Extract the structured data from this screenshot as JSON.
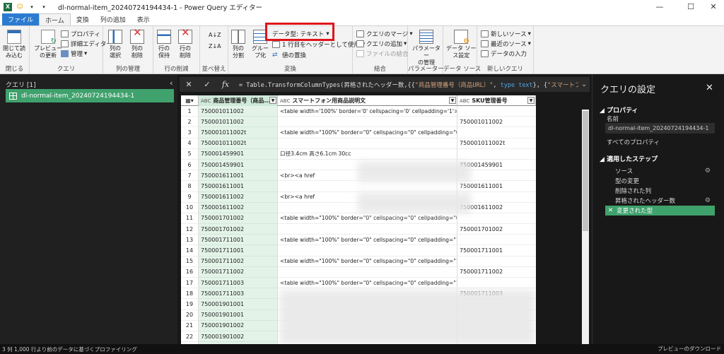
{
  "titlebar": {
    "title": "dl-normal-item_20240724194434-1 - Power Query エディター"
  },
  "tabs": [
    "ファイル",
    "ホーム",
    "変換",
    "列の追加",
    "表示"
  ],
  "ribbon": {
    "close": {
      "label1": "閉じて読",
      "label2": "み込む",
      "group": "閉じる"
    },
    "query": {
      "preview1": "プレビュー",
      "preview2": "の更新",
      "properties": "プロパティ",
      "advanced": "詳細エディター",
      "manage": "管理",
      "group": "クエリ"
    },
    "columns": {
      "select1": "列の",
      "select2": "選択",
      "delete1": "列の",
      "delete2": "削除",
      "group": "列の管理"
    },
    "rows": {
      "keep1": "行の",
      "keep2": "保持",
      "remove1": "行の",
      "remove2": "削除",
      "group": "行の削減"
    },
    "sort": {
      "group": "並べ替え"
    },
    "transform": {
      "split1": "列の",
      "split2": "分割",
      "group1": "グルー",
      "group2": "プ化",
      "datatype": "データ型: テキスト",
      "header": "1 行目をヘッダーとして使用",
      "replace": "値の置換",
      "group": "変換"
    },
    "combine": {
      "merge": "クエリのマージ",
      "append": "クエリの追加",
      "combine": "ファイルの結合",
      "group": "結合"
    },
    "params": {
      "l1": "パラメーター",
      "l2": "の管理",
      "group": "パラメーター"
    },
    "datasource": {
      "l1": "データ ソー",
      "l2": "ス設定",
      "group": "データ ソース"
    },
    "newquery": {
      "newsource": "新しいソース",
      "recent": "最近のソース",
      "enter": "データの入力",
      "group": "新しいクエリ"
    }
  },
  "queries": {
    "header": "クエリ [1]",
    "item": "dl-normal-item_20240724194434-1"
  },
  "formula": {
    "prefix": "= Table.TransformColumnTypes(昇格されたヘッダー数,{{",
    "s1": "\"商品管理番号（商品URL）\"",
    "mid": ", ",
    "k1": "type text",
    "tail": "}, {",
    "s2": "\"スマートフォ"
  },
  "grid": {
    "columns": [
      "商品管理番号（商品...",
      "スマートフォン用商品説明文",
      "SKU管理番号"
    ],
    "types": [
      "ABC",
      "ABC",
      "ABC"
    ],
    "rows": [
      {
        "n": "1",
        "a": "750001011002",
        "b": "<table width='100%' border='0' cellspacing='0' cellpadding='1'><tr><td...",
        "c": ""
      },
      {
        "n": "2",
        "a": "750001011002",
        "b": "",
        "c": "750001011002"
      },
      {
        "n": "3",
        "a": "750001011002t",
        "b": "<table width=\"100%\" border=\"0\" cellspacing=\"0\" cellpadding=\"0\"><tr>...",
        "c": ""
      },
      {
        "n": "4",
        "a": "750001011002t",
        "b": "",
        "c": "750001011002t"
      },
      {
        "n": "5",
        "a": "750001459901",
        "b": "口径3.4cm 高さ6.1cm 30cc",
        "c": ""
      },
      {
        "n": "6",
        "a": "750001459901",
        "b": "",
        "c": "750001459901"
      },
      {
        "n": "7",
        "a": "750001611001",
        "b": "<br><a href",
        "c": ""
      },
      {
        "n": "8",
        "a": "750001611001",
        "b": "",
        "c": "750001611001"
      },
      {
        "n": "9",
        "a": "750001611002",
        "b": "<br><a href",
        "c": ""
      },
      {
        "n": "10",
        "a": "750001611002",
        "b": "",
        "c": "750001611002"
      },
      {
        "n": "11",
        "a": "750001701002",
        "b": "<table width=\"100%\" border=\"0\" cellspacing=\"0\" cellpadding=\"0\"><tr>...",
        "c": ""
      },
      {
        "n": "12",
        "a": "750001701002",
        "b": "",
        "c": "750001701002"
      },
      {
        "n": "13",
        "a": "750001711001",
        "b": "<table width=\"100%\" border=\"0\" cellspacing=\"0\" cellpadding=\"1\"><tr>...",
        "c": ""
      },
      {
        "n": "14",
        "a": "750001711001",
        "b": "",
        "c": "750001711001"
      },
      {
        "n": "15",
        "a": "750001711002",
        "b": "<table width=\"100%\" border=\"0\" cellspacing=\"0\" cellpadding=\"1\"><tr>...",
        "c": ""
      },
      {
        "n": "16",
        "a": "750001711002",
        "b": "",
        "c": "750001711002"
      },
      {
        "n": "17",
        "a": "750001711003",
        "b": "<table width=\"100%\" border=\"0\" cellspacing=\"0\" cellpadding=\"1\"><tr>...",
        "c": ""
      },
      {
        "n": "18",
        "a": "750001711003",
        "b": "",
        "c": "750001711003"
      },
      {
        "n": "19",
        "a": "750001901001",
        "b": "",
        "c": ""
      },
      {
        "n": "20",
        "a": "750001901001",
        "b": "",
        "c": ""
      },
      {
        "n": "21",
        "a": "750001901002",
        "b": "",
        "c": ""
      },
      {
        "n": "22",
        "a": "750001901002",
        "b": "",
        "c": ""
      },
      {
        "n": "23",
        "a": "750001901012",
        "b": "",
        "c": ""
      }
    ]
  },
  "settings": {
    "title": "クエリの設定",
    "properties": "プロパティ",
    "name_label": "名前",
    "name_value": "dl-normal-item_20240724194434-1",
    "all_props": "すべてのプロパティ",
    "applied": "適用したステップ",
    "steps": [
      "ソース",
      "型の変更",
      "削除された列",
      "昇格されたヘッダー数",
      "変更された型"
    ]
  },
  "status": {
    "left": "3 列 1,000 行より前のデータに基づくプロファイリング",
    "right": "プレビューのダウンロード"
  },
  "colors": {
    "accent": "#3fa16c",
    "highlight": "#e0141b",
    "file_tab": "#2b7bd1"
  }
}
